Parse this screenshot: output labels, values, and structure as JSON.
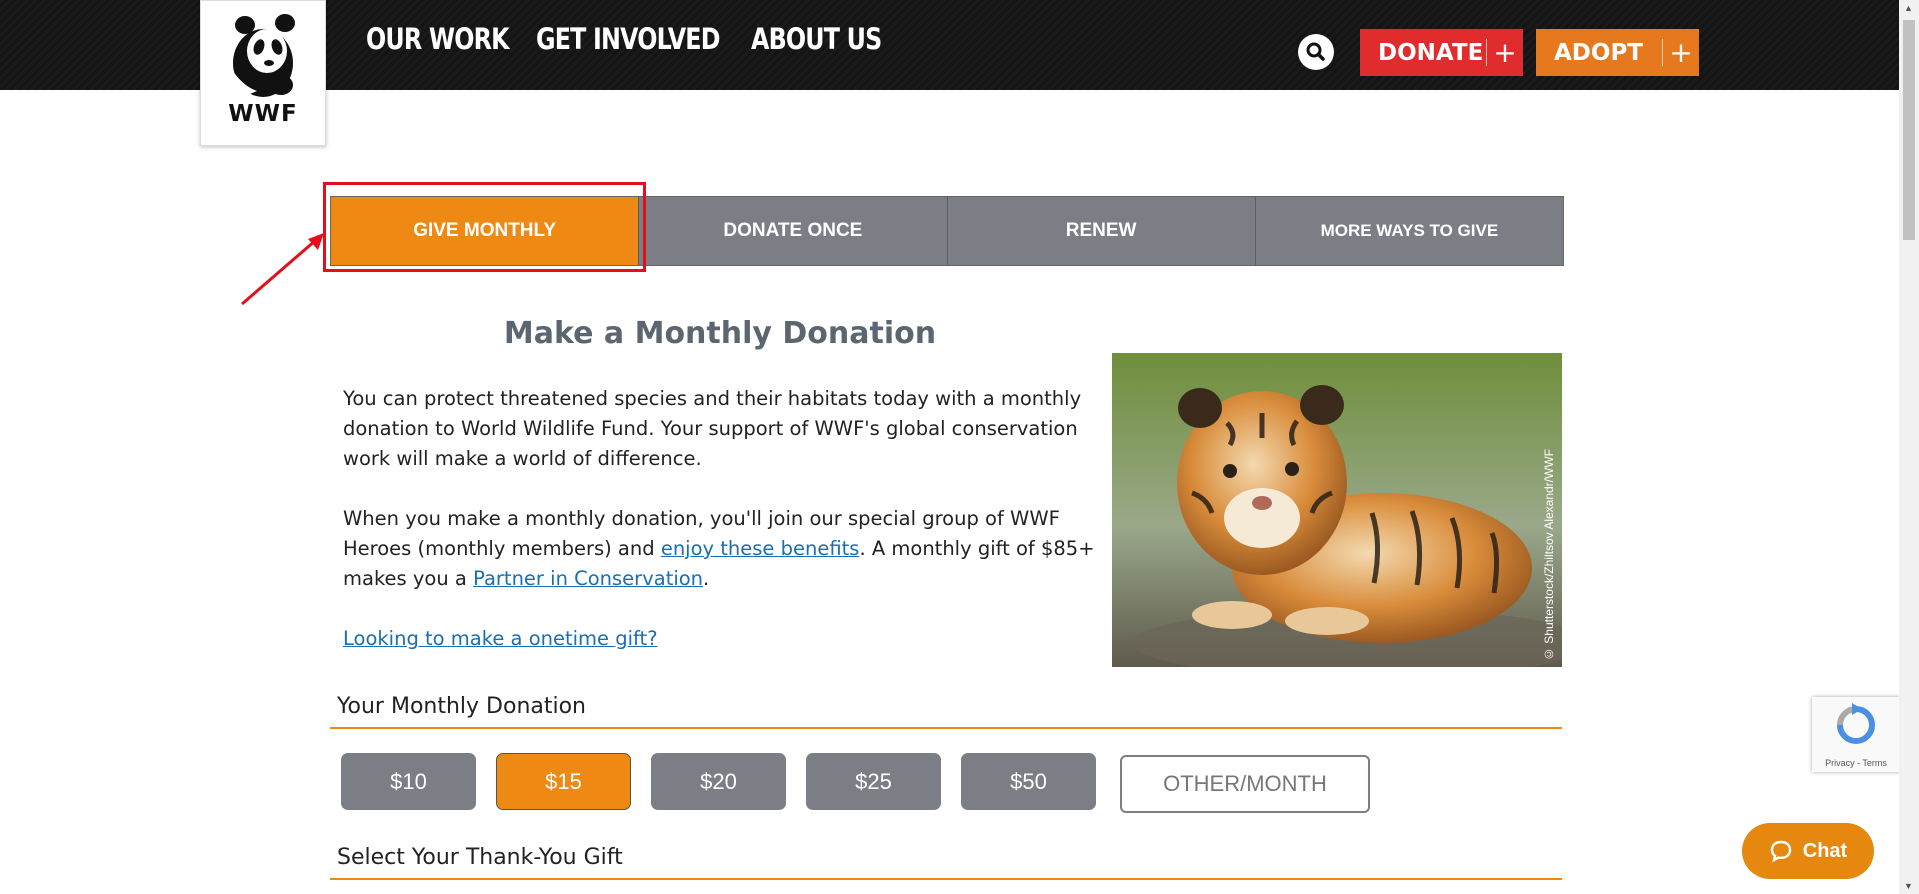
{
  "header": {
    "logo_text": "WWF",
    "nav": [
      "OUR WORK",
      "GET INVOLVED",
      "ABOUT US"
    ],
    "donate_label": "DONATE",
    "adopt_label": "ADOPT",
    "plus": "+"
  },
  "tabs": [
    "GIVE MONTHLY",
    "DONATE ONCE",
    "RENEW",
    "MORE WAYS TO GIVE"
  ],
  "main": {
    "title": "Make a Monthly Donation",
    "para1": "You can protect threatened species and their habitats today with a monthly donation to World Wildlife Fund. Your support of WWF's global conservation work will make a world of difference.",
    "para2_a": "When you make a monthly donation, you'll join our special group of WWF Heroes (monthly members) and ",
    "para2_link1": "enjoy these benefits",
    "para2_b": ". A monthly gift of $85+ makes you a ",
    "para2_link2": "Partner in Conservation",
    "para2_c": ".",
    "onetime_link": "Looking to make a onetime gift?",
    "photo_credit": "© Shutterstock/Zhiltsov Alexandr/WWF"
  },
  "donation": {
    "title": "Your Monthly Donation",
    "amounts": [
      "$10",
      "$15",
      "$20",
      "$25",
      "$50"
    ],
    "selected": "$15",
    "other_placeholder": "OTHER/MONTH"
  },
  "gift": {
    "title": "Select Your Thank-You Gift"
  },
  "recaptcha": {
    "text": "Privacy - Terms"
  },
  "chat": {
    "label": "Chat"
  },
  "colors": {
    "accent": "#ee8a14",
    "donate": "#e02c2c",
    "adopt": "#e6781e",
    "tab_gray": "#7b7e85",
    "link": "#1a6fb0"
  }
}
